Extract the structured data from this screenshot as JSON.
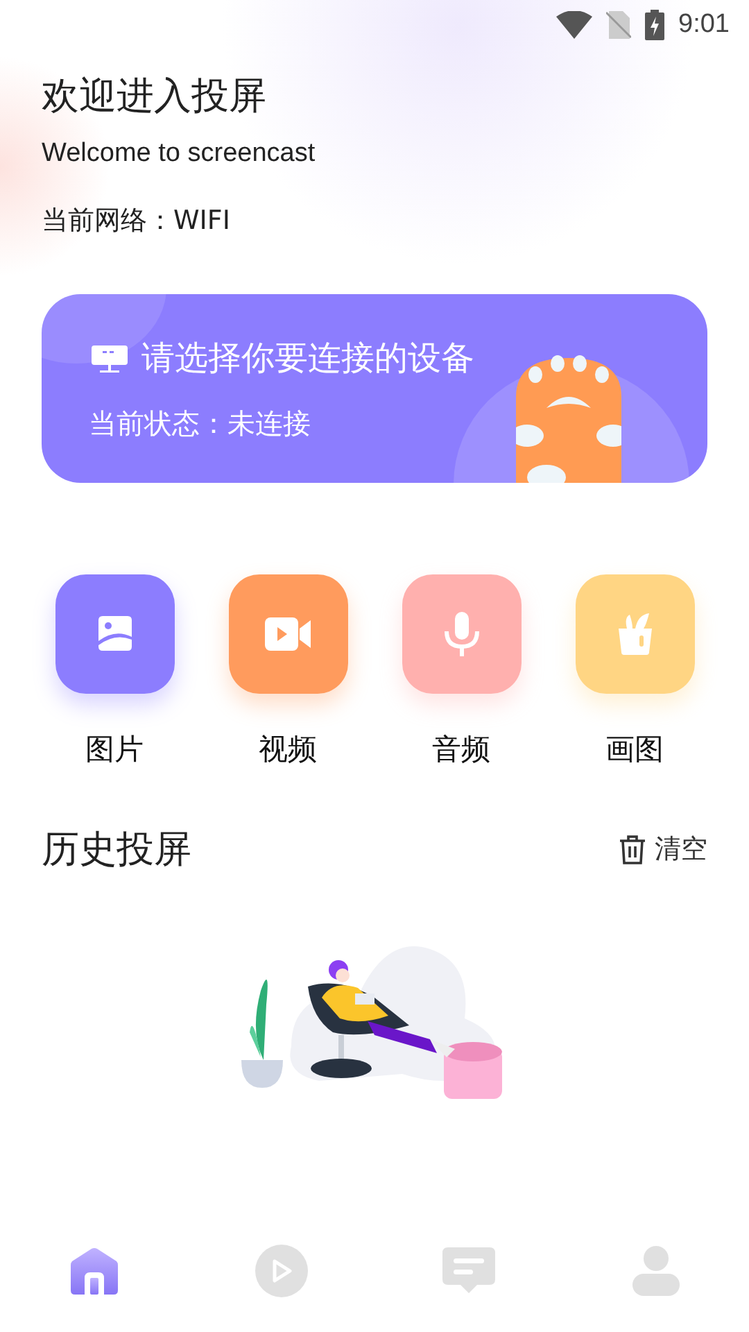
{
  "status_bar": {
    "time": "9:01"
  },
  "header": {
    "title": "欢迎进入投屏",
    "subtitle": "Welcome to screencast",
    "network": "当前网络：WIFI"
  },
  "device_card": {
    "title": "请选择你要连接的设备",
    "status": "当前状态：未连接"
  },
  "media_types": [
    {
      "label": "图片",
      "kind": "image",
      "color": "#8c7dfe"
    },
    {
      "label": "视频",
      "kind": "video",
      "color": "#ff9b5d"
    },
    {
      "label": "音频",
      "kind": "audio",
      "color": "#ffb0ae"
    },
    {
      "label": "画图",
      "kind": "paint",
      "color": "#ffd583"
    }
  ],
  "history": {
    "title": "历史投屏",
    "clear_label": "清空"
  },
  "bottom_nav": [
    {
      "kind": "home",
      "selected": true
    },
    {
      "kind": "play",
      "selected": false
    },
    {
      "kind": "message",
      "selected": false
    },
    {
      "kind": "profile",
      "selected": false
    }
  ]
}
